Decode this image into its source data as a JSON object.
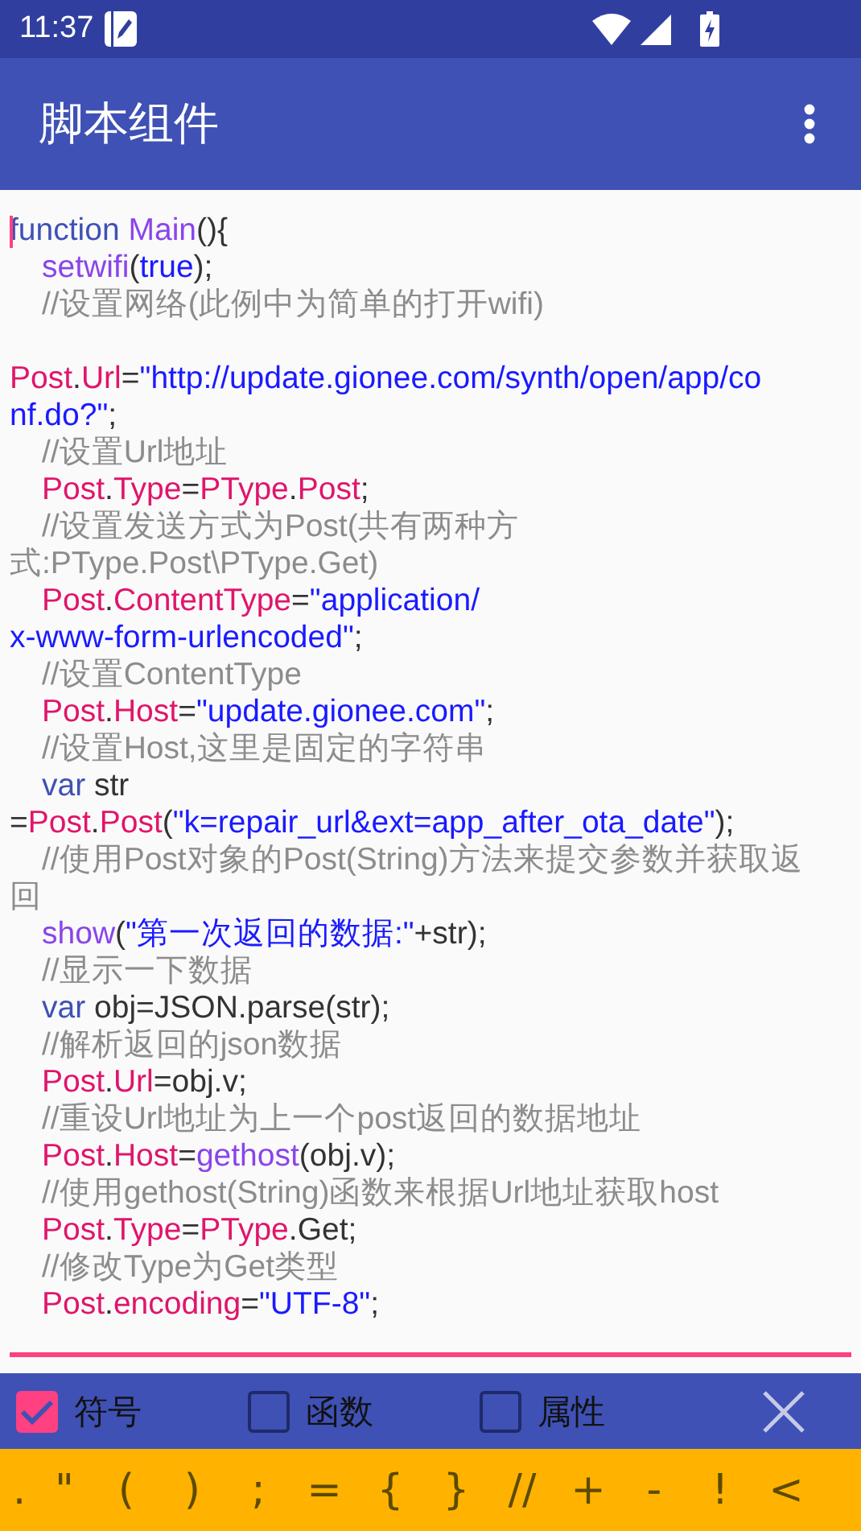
{
  "status_bar": {
    "time": "11:37"
  },
  "app_bar": {
    "title": "脚本组件"
  },
  "editor": {
    "lines": [
      {
        "indent": false,
        "cursor": true,
        "tokens": [
          {
            "text": "function",
            "kind": "keyword"
          },
          {
            "text": " Main",
            "kind": "function"
          },
          {
            "text": "(){",
            "kind": "plain"
          }
        ]
      },
      {
        "indent": true,
        "tokens": [
          {
            "text": "setwifi",
            "kind": "function"
          },
          {
            "text": "(",
            "kind": "plain"
          },
          {
            "text": "true",
            "kind": "string"
          },
          {
            "text": ");",
            "kind": "plain"
          }
        ]
      },
      {
        "indent": true,
        "tokens": [
          {
            "text": "//设置网络(此例中为简单的打开wifi)",
            "kind": "comment"
          }
        ]
      },
      {
        "indent": false,
        "blank_before": true,
        "tokens": [
          {
            "text": "Post",
            "kind": "property"
          },
          {
            "text": ".",
            "kind": "plain"
          },
          {
            "text": "Url",
            "kind": "property"
          },
          {
            "text": "=",
            "kind": "plain"
          },
          {
            "text": "\"http://update.gionee.com/synth/open/app/co",
            "kind": "string"
          }
        ]
      },
      {
        "indent": false,
        "tokens": [
          {
            "text": "nf.do?\"",
            "kind": "string"
          },
          {
            "text": ";",
            "kind": "plain"
          }
        ]
      },
      {
        "indent": true,
        "tokens": [
          {
            "text": "//设置Url地址",
            "kind": "comment"
          }
        ]
      },
      {
        "indent": true,
        "tokens": [
          {
            "text": "Post",
            "kind": "property"
          },
          {
            "text": ".",
            "kind": "plain"
          },
          {
            "text": "Type",
            "kind": "property"
          },
          {
            "text": "=",
            "kind": "plain"
          },
          {
            "text": "PType",
            "kind": "property"
          },
          {
            "text": ".",
            "kind": "plain"
          },
          {
            "text": "Post",
            "kind": "property"
          },
          {
            "text": ";",
            "kind": "plain"
          }
        ]
      },
      {
        "indent": true,
        "tokens": [
          {
            "text": "//设置发送方式为Post(共有两种方",
            "kind": "comment"
          }
        ]
      },
      {
        "indent": false,
        "tokens": [
          {
            "text": "式:PType.Post\\PType.Get)",
            "kind": "comment"
          }
        ]
      },
      {
        "indent": true,
        "tokens": [
          {
            "text": "Post",
            "kind": "property"
          },
          {
            "text": ".",
            "kind": "plain"
          },
          {
            "text": "ContentType",
            "kind": "property"
          },
          {
            "text": "=",
            "kind": "plain"
          },
          {
            "text": "\"application/",
            "kind": "string"
          }
        ]
      },
      {
        "indent": false,
        "tokens": [
          {
            "text": "x-www-form-urlencoded\"",
            "kind": "string"
          },
          {
            "text": ";",
            "kind": "plain"
          }
        ]
      },
      {
        "indent": true,
        "tokens": [
          {
            "text": "//设置ContentType",
            "kind": "comment"
          }
        ]
      },
      {
        "indent": true,
        "tokens": [
          {
            "text": "Post",
            "kind": "property"
          },
          {
            "text": ".",
            "kind": "plain"
          },
          {
            "text": "Host",
            "kind": "property"
          },
          {
            "text": "=",
            "kind": "plain"
          },
          {
            "text": "\"update.gionee.com\"",
            "kind": "string"
          },
          {
            "text": ";",
            "kind": "plain"
          }
        ]
      },
      {
        "indent": true,
        "tokens": [
          {
            "text": "//设置Host,这里是固定的字符串",
            "kind": "comment"
          }
        ]
      },
      {
        "indent": true,
        "tokens": [
          {
            "text": "var",
            "kind": "keyword"
          },
          {
            "text": " str",
            "kind": "plain"
          }
        ]
      },
      {
        "indent": false,
        "tokens": [
          {
            "text": "=",
            "kind": "plain"
          },
          {
            "text": "Post",
            "kind": "property"
          },
          {
            "text": ".",
            "kind": "plain"
          },
          {
            "text": "Post",
            "kind": "property"
          },
          {
            "text": "(",
            "kind": "plain"
          },
          {
            "text": "\"k=repair_url&ext=app_after_ota_date\"",
            "kind": "string"
          },
          {
            "text": ");",
            "kind": "plain"
          }
        ]
      },
      {
        "indent": true,
        "tokens": [
          {
            "text": "//使用Post对象的Post(String)方法来提交参数并获取返",
            "kind": "comment"
          }
        ]
      },
      {
        "indent": false,
        "tokens": [
          {
            "text": "回",
            "kind": "comment"
          }
        ]
      },
      {
        "indent": true,
        "tokens": [
          {
            "text": "show",
            "kind": "function"
          },
          {
            "text": "(",
            "kind": "plain"
          },
          {
            "text": "\"第一次返回的数据:\"",
            "kind": "string"
          },
          {
            "text": "+str);",
            "kind": "plain"
          }
        ]
      },
      {
        "indent": true,
        "tokens": [
          {
            "text": "//显示一下数据",
            "kind": "comment"
          }
        ]
      },
      {
        "indent": true,
        "tokens": [
          {
            "text": "var",
            "kind": "keyword"
          },
          {
            "text": " obj=JSON.parse(str);",
            "kind": "plain"
          }
        ]
      },
      {
        "indent": true,
        "tokens": [
          {
            "text": "//解析返回的json数据",
            "kind": "comment"
          }
        ]
      },
      {
        "indent": true,
        "tokens": [
          {
            "text": "Post",
            "kind": "property"
          },
          {
            "text": ".",
            "kind": "plain"
          },
          {
            "text": "Url",
            "kind": "property"
          },
          {
            "text": "=obj.v;",
            "kind": "plain"
          }
        ]
      },
      {
        "indent": true,
        "tokens": [
          {
            "text": "//重设Url地址为上一个post返回的数据地址",
            "kind": "comment"
          }
        ]
      },
      {
        "indent": true,
        "tokens": [
          {
            "text": "Post",
            "kind": "property"
          },
          {
            "text": ".",
            "kind": "plain"
          },
          {
            "text": "Host",
            "kind": "property"
          },
          {
            "text": "=",
            "kind": "plain"
          },
          {
            "text": "gethost",
            "kind": "function"
          },
          {
            "text": "(obj.v);",
            "kind": "plain"
          }
        ]
      },
      {
        "indent": true,
        "tokens": [
          {
            "text": "//使用gethost(String)函数来根据Url地址获取host",
            "kind": "comment"
          }
        ]
      },
      {
        "indent": true,
        "tokens": [
          {
            "text": "Post",
            "kind": "property"
          },
          {
            "text": ".",
            "kind": "plain"
          },
          {
            "text": "Type",
            "kind": "property"
          },
          {
            "text": "=",
            "kind": "plain"
          },
          {
            "text": "PType",
            "kind": "property"
          },
          {
            "text": ".Get;",
            "kind": "plain"
          }
        ]
      },
      {
        "indent": true,
        "tokens": [
          {
            "text": "//修改Type为Get类型",
            "kind": "comment"
          }
        ]
      },
      {
        "indent": true,
        "tokens": [
          {
            "text": "Post",
            "kind": "property"
          },
          {
            "text": ".",
            "kind": "plain"
          },
          {
            "text": "encoding",
            "kind": "property"
          },
          {
            "text": "=",
            "kind": "plain"
          },
          {
            "text": "\"UTF-8\"",
            "kind": "string"
          },
          {
            "text": ";",
            "kind": "plain"
          }
        ]
      }
    ]
  },
  "filters": [
    {
      "label": "符号",
      "checked": true
    },
    {
      "label": "函数",
      "checked": false
    },
    {
      "label": "属性",
      "checked": false
    }
  ],
  "symbols": [
    ".",
    "\"",
    "(",
    ")",
    ";",
    "=",
    "{",
    "}",
    "//",
    "+",
    "-",
    "!",
    "<"
  ]
}
